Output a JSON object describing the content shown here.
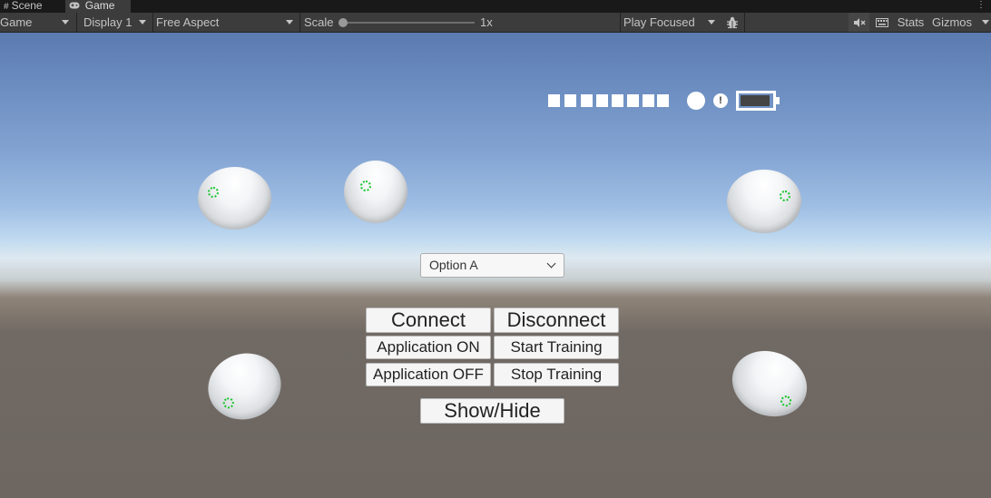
{
  "tabs": {
    "scene": {
      "label": "Scene",
      "icon": "grid-icon"
    },
    "game": {
      "label": "Game",
      "icon": "gamepad-icon"
    }
  },
  "toolbar": {
    "game_dropdown": "Game",
    "display": "Display 1",
    "aspect": "Free Aspect",
    "scale_label": "Scale",
    "scale_value": "1x",
    "scale_slider_fraction": 0,
    "play_mode": "Play Focused",
    "stats": "Stats",
    "gizmos": "Gizmos"
  },
  "hud": {
    "signal_count": 8,
    "alert": "!",
    "battery_level": 0.85
  },
  "dropdown": {
    "selected": "Option A"
  },
  "buttons": {
    "connect": "Connect",
    "disconnect": "Disconnect",
    "application_on": "Application ON",
    "start_training": "Start Training",
    "application_off": "Application OFF",
    "stop_training": "Stop Training",
    "show_hide": "Show/Hide"
  },
  "colors": {
    "marker": "#18c52c",
    "toolbar_bg": "#3c3c3c",
    "tab_bg": "#191919"
  }
}
